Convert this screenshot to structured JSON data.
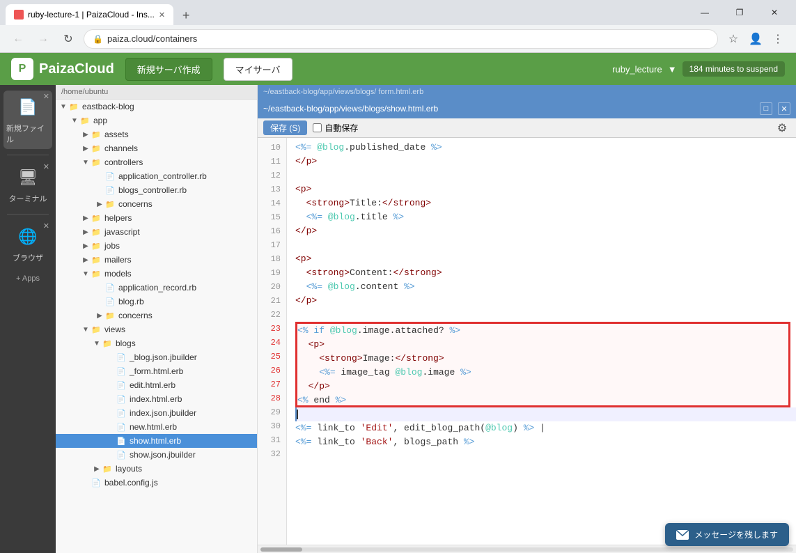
{
  "browser": {
    "tab_title": "ruby-lecture-1 | PaizaCloud - Ins...",
    "tab_favicon": "P",
    "address": "paiza.cloud/containers",
    "window_min": "—",
    "window_max": "❐",
    "window_close": "✕"
  },
  "paiza": {
    "logo_text": "PaizaCloud",
    "logo_icon": "P",
    "nav_new_server": "新規サーバ作成",
    "nav_my_server": "マイサーバ",
    "account": "ruby_lecture",
    "suspend_info": "184 minutes to suspend"
  },
  "sidebar": {
    "items": [
      {
        "label": "新規ファイル",
        "icon": "📄"
      },
      {
        "label": "ターミナル",
        "icon": "🖥"
      },
      {
        "label": "ブラウザ",
        "icon": "🌐"
      }
    ],
    "add_label": "+ Apps"
  },
  "file_tree": {
    "root": "/home/ubuntu",
    "items": [
      {
        "indent": 0,
        "type": "folder",
        "open": true,
        "name": "eastback-blog"
      },
      {
        "indent": 1,
        "type": "folder",
        "open": true,
        "name": "app"
      },
      {
        "indent": 2,
        "type": "folder",
        "open": false,
        "name": "assets"
      },
      {
        "indent": 2,
        "type": "folder",
        "open": false,
        "name": "channels"
      },
      {
        "indent": 2,
        "type": "folder",
        "open": true,
        "name": "controllers"
      },
      {
        "indent": 3,
        "type": "file",
        "name": "application_controller.rb"
      },
      {
        "indent": 3,
        "type": "file",
        "name": "blogs_controller.rb"
      },
      {
        "indent": 3,
        "type": "folder",
        "open": false,
        "name": "concerns"
      },
      {
        "indent": 2,
        "type": "folder",
        "open": false,
        "name": "helpers"
      },
      {
        "indent": 2,
        "type": "folder",
        "open": false,
        "name": "javascript"
      },
      {
        "indent": 2,
        "type": "folder",
        "open": false,
        "name": "jobs"
      },
      {
        "indent": 2,
        "type": "folder",
        "open": false,
        "name": "mailers"
      },
      {
        "indent": 2,
        "type": "folder",
        "open": true,
        "name": "models"
      },
      {
        "indent": 3,
        "type": "file",
        "name": "application_record.rb"
      },
      {
        "indent": 3,
        "type": "file",
        "name": "blog.rb"
      },
      {
        "indent": 3,
        "type": "folder",
        "open": false,
        "name": "concerns"
      },
      {
        "indent": 2,
        "type": "folder",
        "open": true,
        "name": "views"
      },
      {
        "indent": 3,
        "type": "folder",
        "open": true,
        "name": "blogs"
      },
      {
        "indent": 4,
        "type": "file",
        "name": "_blog.json.jbuilder"
      },
      {
        "indent": 4,
        "type": "file",
        "name": "_form.html.erb"
      },
      {
        "indent": 4,
        "type": "file",
        "name": "edit.html.erb"
      },
      {
        "indent": 4,
        "type": "file",
        "name": "index.html.erb"
      },
      {
        "indent": 4,
        "type": "file",
        "name": "index.json.jbuilder"
      },
      {
        "indent": 4,
        "type": "file",
        "name": "new.html.erb"
      },
      {
        "indent": 4,
        "type": "file",
        "name": "show.html.erb",
        "selected": true
      },
      {
        "indent": 4,
        "type": "file",
        "name": "show.json.jbuilder"
      },
      {
        "indent": 3,
        "type": "folder",
        "open": false,
        "name": "layouts"
      },
      {
        "indent": 2,
        "type": "file",
        "name": "babel.config.js"
      }
    ]
  },
  "editor": {
    "inactive_tab": "~/eastback-blog/app/views/blogs/  form.html.erb",
    "active_tab": "~/eastback-blog/app/views/blogs/show.html.erb",
    "save_btn": "保存 (S)",
    "autosave_label": "自動保存",
    "lines": [
      {
        "num": 10,
        "content": "  <%= @blog.published_date %>"
      },
      {
        "num": 11,
        "content": "</p>"
      },
      {
        "num": 12,
        "content": ""
      },
      {
        "num": 13,
        "content": "<p>"
      },
      {
        "num": 14,
        "content": "  <strong>Title:</strong>"
      },
      {
        "num": 15,
        "content": "  <%= @blog.title %>"
      },
      {
        "num": 16,
        "content": "</p>"
      },
      {
        "num": 17,
        "content": ""
      },
      {
        "num": 18,
        "content": "<p>"
      },
      {
        "num": 19,
        "content": "  <strong>Content:</strong>"
      },
      {
        "num": 20,
        "content": "  <%= @blog.content %>"
      },
      {
        "num": 21,
        "content": "</p>"
      },
      {
        "num": 22,
        "content": ""
      },
      {
        "num": 23,
        "content": "<% if @blog.image.attached? %>",
        "highlight": true
      },
      {
        "num": 24,
        "content": "  <p>",
        "highlight": true
      },
      {
        "num": 25,
        "content": "    <strong>Image:</strong>",
        "highlight": true
      },
      {
        "num": 26,
        "content": "    <%= image_tag @blog.image %>",
        "highlight": true
      },
      {
        "num": 27,
        "content": "  </p>",
        "highlight": true
      },
      {
        "num": 28,
        "content": "<% end %>",
        "highlight": true
      },
      {
        "num": 29,
        "content": ""
      },
      {
        "num": 30,
        "content": "<%= link_to 'Edit', edit_blog_path(@blog) %> |"
      },
      {
        "num": 31,
        "content": "<%= link_to 'Back', blogs_path %>"
      },
      {
        "num": 32,
        "content": ""
      }
    ]
  },
  "message_btn": "メッセージを残します"
}
